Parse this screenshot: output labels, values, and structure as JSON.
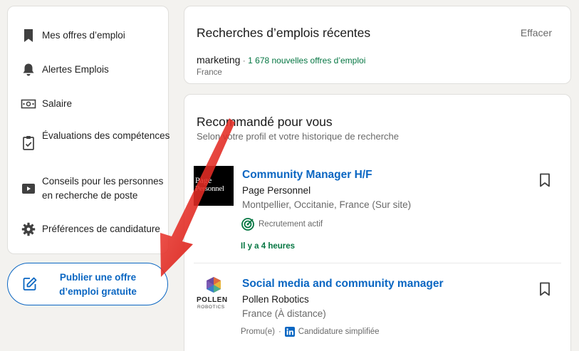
{
  "sidebar": {
    "items": [
      {
        "label": "Mes offres d’emploi",
        "icon": "bookmark-icon"
      },
      {
        "label": "Alertes Emplois",
        "icon": "bell-icon"
      },
      {
        "label": "Salaire",
        "icon": "banknote-icon"
      },
      {
        "label": "Évaluations des compétences",
        "icon": "clipboard-check-icon"
      },
      {
        "label": "Conseils pour les personnes en recherche de poste",
        "icon": "video-play-icon"
      },
      {
        "label": "Préférences de candidature",
        "icon": "gear-icon"
      }
    ]
  },
  "publish": {
    "label": "Publier une offre d’emploi gratuite",
    "icon": "edit-icon"
  },
  "recent": {
    "title": "Recherches d’emplois récentes",
    "clear_label": "Effacer",
    "searches": [
      {
        "term": "marketing",
        "separator": " · ",
        "count": "1 678 nouvelles offres d’emploi",
        "location": "France"
      }
    ]
  },
  "recommended": {
    "title": "Recommandé pour vous",
    "subtitle": "Selon votre profil et votre historique de recherche",
    "jobs": [
      {
        "title": "Community Manager H/F",
        "company": "Page Personnel",
        "location": "Montpellier, Occitanie, France (Sur site)",
        "badge": "Recrutement actif",
        "posted": "Il y a 4 heures",
        "logo_text_1": "Page",
        "logo_text_2": "Personnel"
      },
      {
        "title": "Social media and community manager",
        "company": "Pollen Robotics",
        "location": "France (À distance)",
        "promoted": "Promu(e)",
        "separator": "·",
        "apply": "Candidature simplifiée",
        "logo_text_1": "POLLEN",
        "logo_text_2": "ROBOTICS"
      }
    ]
  },
  "colors": {
    "accent": "#0a66c2",
    "green": "#057642",
    "arrow": "#e0201b",
    "background": "#f3f2ef"
  }
}
